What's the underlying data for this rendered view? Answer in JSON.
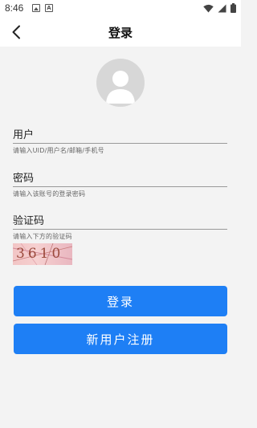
{
  "status": {
    "time": "8:46"
  },
  "header": {
    "title": "登录"
  },
  "fields": {
    "user": {
      "label": "用户",
      "hint": "请输入UID/用户名/邮箱/手机号"
    },
    "password": {
      "label": "密码",
      "hint": "请输入该账号的登录密码"
    },
    "captcha": {
      "label": "验证码",
      "hint": "请输入下方的验证码",
      "image_text": "3610"
    }
  },
  "buttons": {
    "login": "登录",
    "register": "新用户注册"
  },
  "colors": {
    "primary": "#1e7ff5",
    "avatar": "#d7d7d7",
    "background": "#f3f3f3"
  },
  "icons": {
    "back": "chevron-left-icon",
    "avatar": "user-silhouette-icon",
    "status": [
      "image-icon",
      "a-icon",
      "wifi-icon",
      "signal-icon",
      "battery-icon"
    ]
  }
}
